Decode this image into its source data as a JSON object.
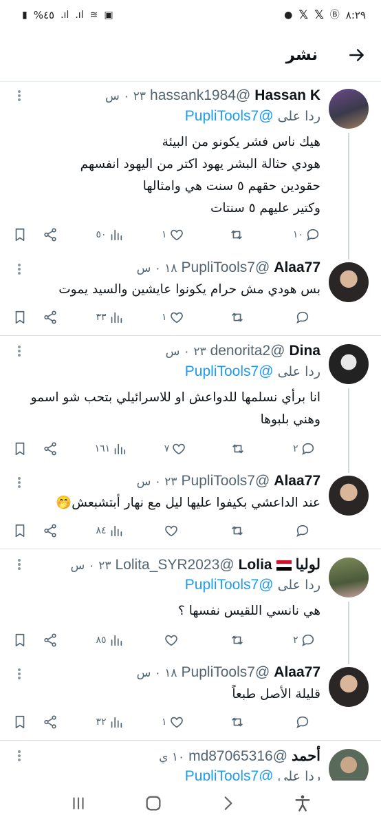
{
  "status": {
    "time": "٨:٢٩",
    "battery": "%٤٥"
  },
  "header": {
    "title": "نشر"
  },
  "posts": [
    {
      "name": "Hassan K",
      "handle": "@hassank1984",
      "time": "٢٣ ٠ س",
      "reply_prefix": "ردا على",
      "reply_to": "@PupliTools7",
      "body_lines": [
        "هيك ناس فشر يكونو من البيئة",
        "هودي حثالة البشر يهود اكتر من اليهود انفسهم",
        "حقودين حقهم ٥ سنت هي وامثالها",
        "وكتير عليهم ٥ سنتات"
      ],
      "replies": "١٠",
      "retweets": "",
      "likes": "١",
      "views": "٥٠"
    },
    {
      "name": "Alaa77",
      "handle": "@PupliTools7",
      "time": "١٨ ٠ س",
      "body_lines": [
        "بس هودي مش حرام يكونوا عايشين والسيد يموت"
      ],
      "replies": "",
      "retweets": "",
      "likes": "١",
      "views": "٣٣"
    },
    {
      "name": "Dina",
      "handle": "@denorita2",
      "time": "٢٣ ٠ س",
      "reply_prefix": "ردا على",
      "reply_to": "@PupliTools7",
      "body_lines": [
        "انا برأي نسلمها للدواعش او للاسرائيلي بتحب شو اسمو",
        "وهني بلبوها"
      ],
      "replies": "٢",
      "retweets": "",
      "likes": "٧",
      "views": "١٦١"
    },
    {
      "name": "Alaa77",
      "handle": "@PupliTools7",
      "time": "٢٣ ٠ س",
      "body_lines": [
        "عند الداعشي بكيفوا عليها ليل مع نهار أبتشبعش🤭"
      ],
      "replies": "",
      "retweets": "",
      "likes": "",
      "views": "٨٤"
    },
    {
      "name": "Lolia",
      "name_extra": "لوليا",
      "handle": "@Lolita_SYR2023",
      "time": "٢٣ ٠ س",
      "reply_prefix": "ردا على",
      "reply_to": "@PupliTools7",
      "body_lines": [
        "هي نانسي اللقيس نفسها ؟"
      ],
      "replies": "٢",
      "retweets": "",
      "likes": "",
      "views": "٨٥"
    },
    {
      "name": "Alaa77",
      "handle": "@PupliTools7",
      "time": "١٨ ٠ س",
      "body_lines": [
        "قليلة الأصل طبعاً"
      ],
      "replies": "",
      "retweets": "",
      "likes": "١",
      "views": "٣٢"
    },
    {
      "name": "أحمد",
      "handle": "@md87065316",
      "time": "١٠ ي",
      "reply_prefix": "ردا على",
      "reply_to": "@PupliTools7"
    }
  ],
  "colors": {
    "accent": "#1d9bf0",
    "muted": "#536471",
    "line": "#cfd9de"
  }
}
